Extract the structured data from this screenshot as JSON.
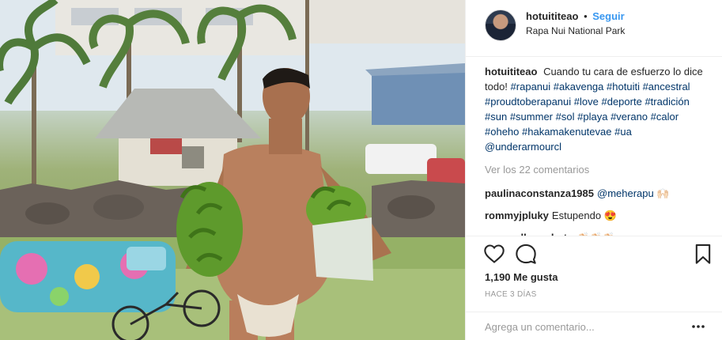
{
  "post": {
    "username": "hotuititeao",
    "follow_label": "Seguir",
    "separator": "•",
    "location": "Rapa Nui National Park",
    "caption": {
      "text": "Cuando tu cara de esfuerzo lo dice todo!",
      "hashtags": [
        "#rapanui",
        "#akavenga",
        "#hotuiti",
        "#ancestral",
        "#proudtoberapanui",
        "#love",
        "#deporte",
        "#tradición",
        "#sun",
        "#summer",
        "#sol",
        "#playa",
        "#verano",
        "#calor",
        "#oheho",
        "#hakamakenutevae",
        "#ua",
        "@underarmourcl"
      ]
    },
    "view_all_label": "Ver los 22 comentarios",
    "comments": [
      {
        "username": "paulinaconstanza1985",
        "text": "@meherapu 🙌🏻"
      },
      {
        "username": "rommyjpluky",
        "text": "Estupendo 😍"
      },
      {
        "username": "macarellanophoto",
        "text": "👏🏻👏🏻👏🏻"
      }
    ],
    "likes_label": "1,190 Me gusta",
    "time_label": "HACE 3 DÍAS",
    "comment_placeholder": "Agrega un comentario...",
    "icons": {
      "like": "heart-icon",
      "comment": "speech-bubble-icon",
      "save": "bookmark-icon",
      "more": "more-options-icon"
    }
  },
  "photo": {
    "subject": "photo",
    "colors": {
      "sky": "#cfe0ea",
      "grass": "#9fb279",
      "bananas": "#5e9a2c",
      "roof": "#b7b9b5"
    }
  }
}
